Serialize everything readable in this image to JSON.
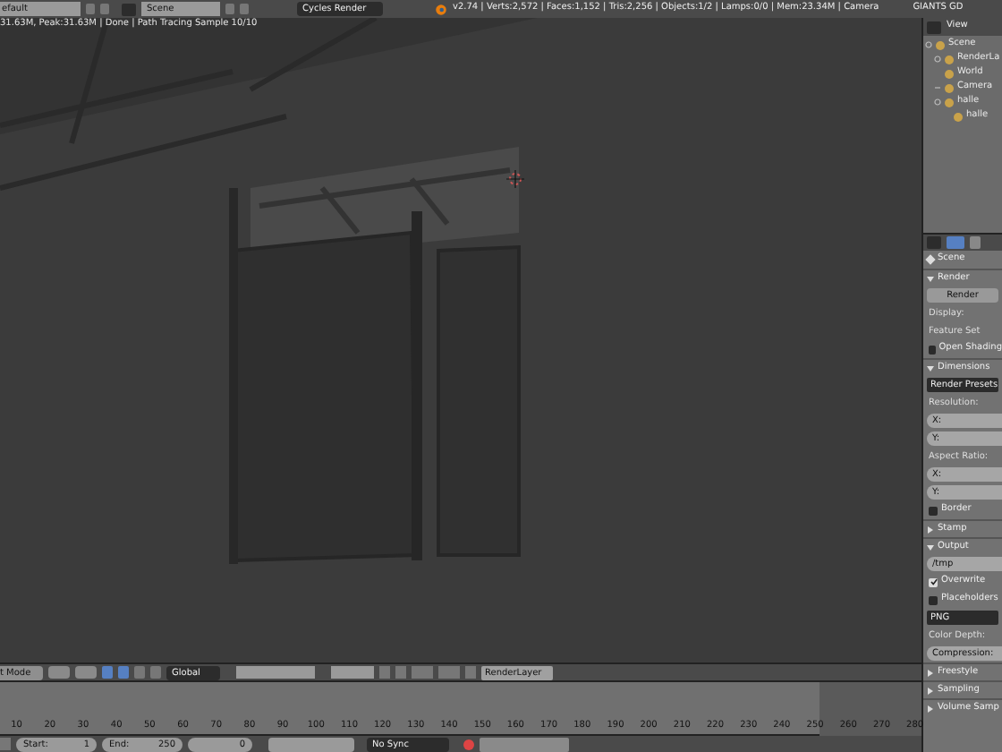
{
  "top_bar": {
    "layout": "efault",
    "scene": "Scene",
    "engine": "Cycles Render",
    "stats": "v2.74 | Verts:2,572 | Faces:1,152 | Tris:2,256 | Objects:1/2 | Lamps:0/0 | Mem:23.34M | Camera",
    "extra": "GIANTS GD"
  },
  "viewport": {
    "info": "31.63M, Peak:31.63M | Done | Path Tracing Sample 10/10"
  },
  "viewport_header": {
    "mode": "t Mode",
    "orientation": "Global",
    "render_layer": "RenderLayer"
  },
  "outliner": {
    "header": "View",
    "items": [
      {
        "label": "Scene",
        "expanded": true,
        "children": [
          {
            "label": "RenderLa",
            "expanded": true
          },
          {
            "label": "World"
          },
          {
            "label": "Camera",
            "expanded": false
          },
          {
            "label": "halle",
            "expanded": true,
            "children": [
              {
                "label": "halle"
              }
            ]
          }
        ]
      }
    ]
  },
  "properties": {
    "context": "Scene",
    "rows": [
      {
        "kind": "panel",
        "label": "Render",
        "expanded": true
      },
      {
        "kind": "button",
        "label": "Render"
      },
      {
        "kind": "label",
        "label": "Display:"
      },
      {
        "kind": "label",
        "label": "Feature Set"
      },
      {
        "kind": "checkbox",
        "label": "Open Shading",
        "checked": false
      },
      {
        "kind": "panel",
        "label": "Dimensions",
        "expanded": true
      },
      {
        "kind": "menu",
        "label": "Render Presets"
      },
      {
        "kind": "label",
        "label": "Resolution:"
      },
      {
        "kind": "field",
        "label": "X:"
      },
      {
        "kind": "field",
        "label": "Y:"
      },
      {
        "kind": "label",
        "label": "Aspect Ratio:"
      },
      {
        "kind": "field",
        "label": "X:"
      },
      {
        "kind": "field",
        "label": "Y:"
      },
      {
        "kind": "checkbox",
        "label": "Border",
        "checked": false
      },
      {
        "kind": "panel",
        "label": "Stamp",
        "expanded": false
      },
      {
        "kind": "panel",
        "label": "Output",
        "expanded": true
      },
      {
        "kind": "field",
        "label": "/tmp"
      },
      {
        "kind": "checkbox",
        "label": "Overwrite",
        "checked": true
      },
      {
        "kind": "checkbox",
        "label": "Placeholders",
        "checked": false
      },
      {
        "kind": "menu",
        "label": "PNG"
      },
      {
        "kind": "label",
        "label": "Color Depth:"
      },
      {
        "kind": "field",
        "label": "Compression:"
      },
      {
        "kind": "panel",
        "label": "Freestyle",
        "expanded": false
      },
      {
        "kind": "panel",
        "label": "Sampling",
        "expanded": false
      },
      {
        "kind": "panel",
        "label": "Volume Samp",
        "expanded": false
      }
    ]
  },
  "timeline": {
    "ticks": [
      "10",
      "20",
      "30",
      "40",
      "50",
      "60",
      "70",
      "80",
      "90",
      "100",
      "110",
      "120",
      "130",
      "140",
      "150",
      "160",
      "170",
      "180",
      "190",
      "200",
      "210",
      "220",
      "230",
      "240",
      "250",
      "260",
      "270",
      "280"
    ],
    "start_label": "Start:",
    "start": "1",
    "end_label": "End:",
    "end": "250",
    "current": "0",
    "sync": "No Sync"
  }
}
